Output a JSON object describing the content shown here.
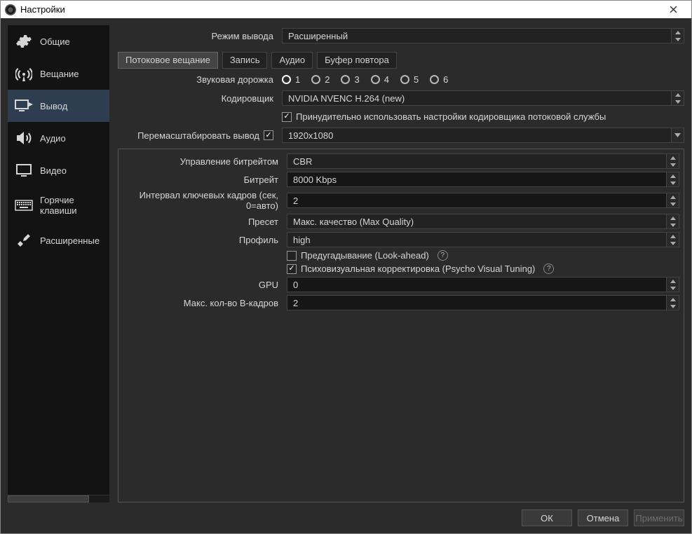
{
  "window": {
    "title": "Настройки"
  },
  "sidebar": {
    "items": [
      {
        "label": "Общие"
      },
      {
        "label": "Вещание"
      },
      {
        "label": "Вывод"
      },
      {
        "label": "Аудио"
      },
      {
        "label": "Видео"
      },
      {
        "label": "Горячие клавиши"
      },
      {
        "label": "Расширенные"
      }
    ]
  },
  "top": {
    "output_mode_label": "Режим вывода",
    "output_mode_value": "Расширенный"
  },
  "tabs": {
    "streaming": "Потоковое вещание",
    "recording": "Запись",
    "audio": "Аудио",
    "replay": "Буфер повтора"
  },
  "tracks": {
    "label": "Звуковая дорожка",
    "options": [
      "1",
      "2",
      "3",
      "4",
      "5",
      "6"
    ]
  },
  "encoder": {
    "label": "Кодировщик",
    "value": "NVIDIA NVENC H.264 (new)",
    "enforce_label": "Принудительно использовать настройки кодировщика потоковой службы"
  },
  "rescale": {
    "label": "Перемасштабировать вывод",
    "value": "1920x1080"
  },
  "enc": {
    "rate_label": "Управление битрейтом",
    "rate_value": "CBR",
    "bitrate_label": "Битрейт",
    "bitrate_value": "8000 Kbps",
    "keyint_label": "Интервал ключевых кадров (сек, 0=авто)",
    "keyint_value": "2",
    "preset_label": "Пресет",
    "preset_value": "Макс. качество (Max Quality)",
    "profile_label": "Профиль",
    "profile_value": "high",
    "lookahead_label": "Предугадывание (Look-ahead)",
    "psycho_label": "Психовизуальная корректировка (Psycho Visual Tuning)",
    "gpu_label": "GPU",
    "gpu_value": "0",
    "bframes_label": "Макс. кол-во В-кадров",
    "bframes_value": "2"
  },
  "footer": {
    "ok": "ОК",
    "cancel": "Отмена",
    "apply": "Применить"
  }
}
